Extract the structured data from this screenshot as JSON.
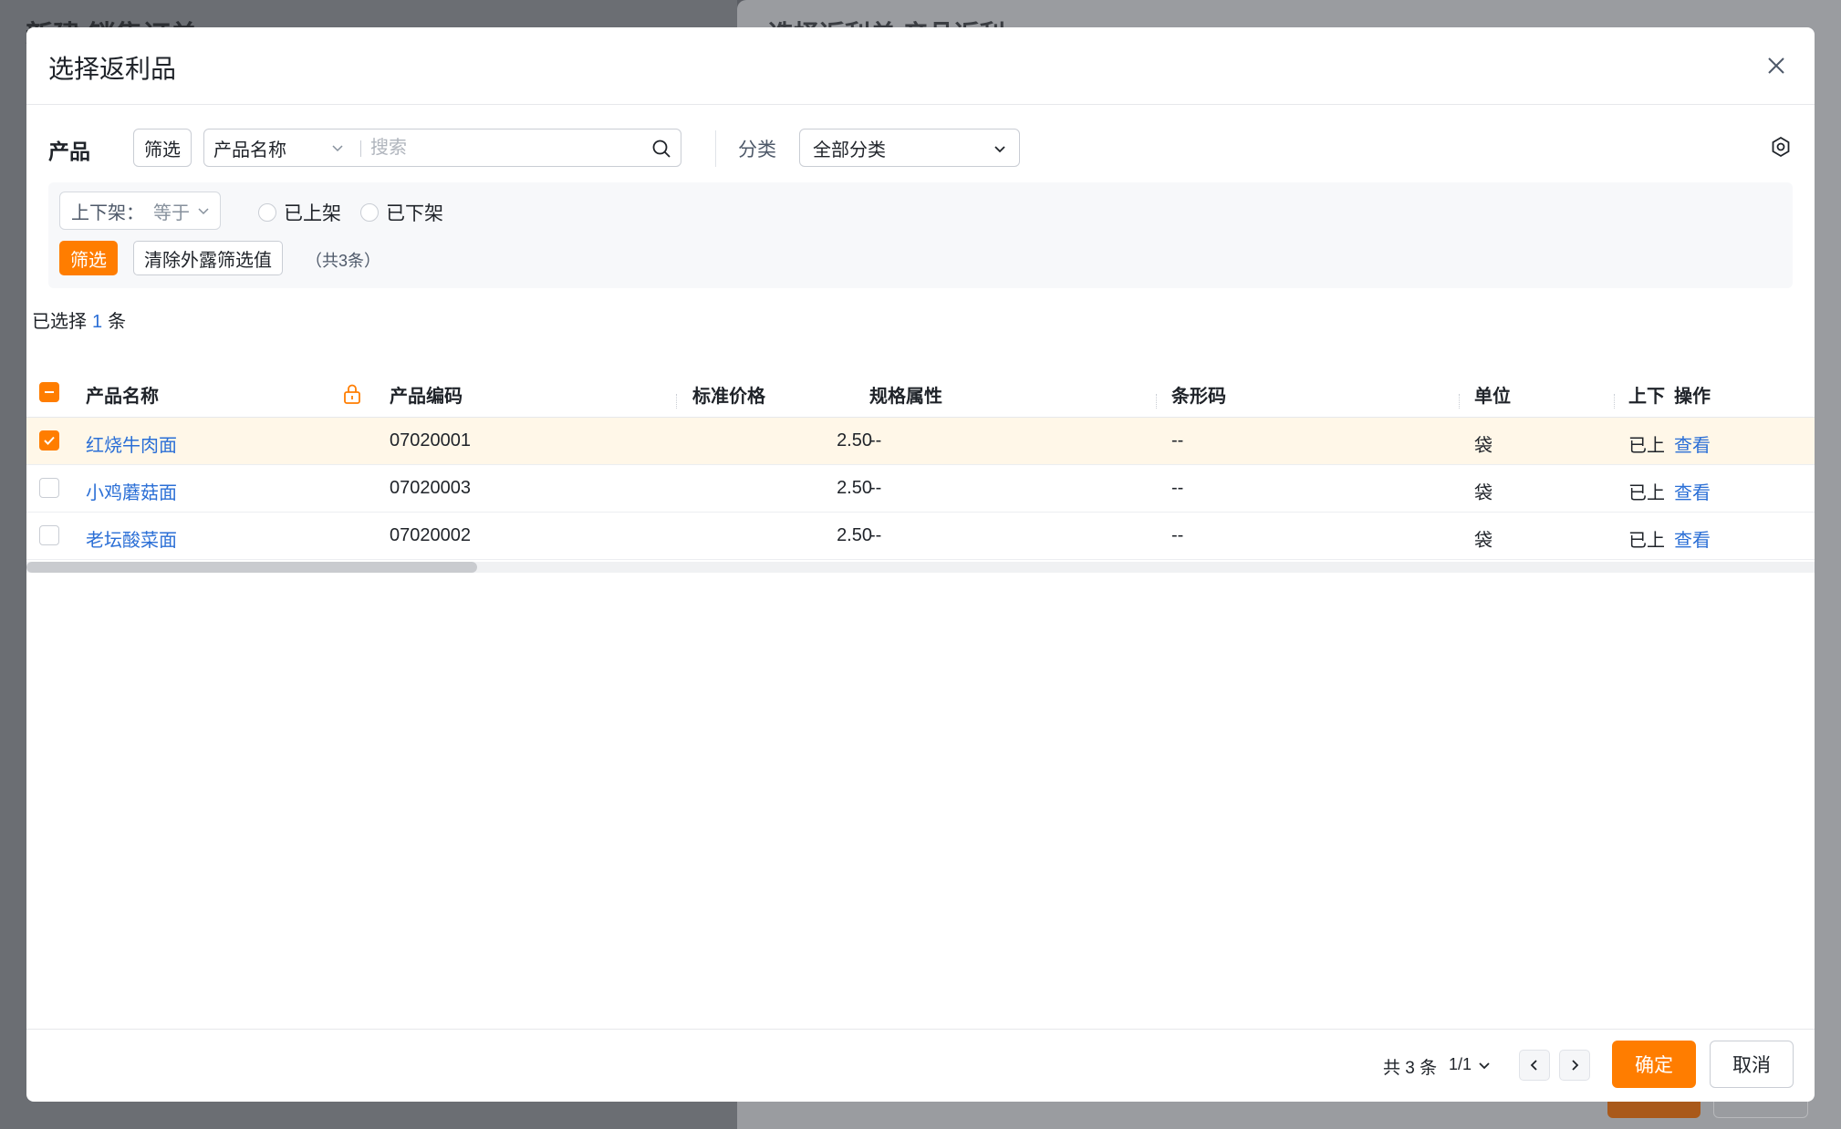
{
  "background": {
    "left_title": "新建 销售订单",
    "right_title": "选择返利单 产品返利"
  },
  "modal": {
    "title": "选择返利品",
    "toolbar": {
      "label": "产品",
      "filter_button": "筛选",
      "search_field": "产品名称",
      "search_placeholder": "搜索",
      "category_label": "分类",
      "category_value": "全部分类"
    },
    "filter_panel": {
      "field_label": "上下架：",
      "operator": "等于",
      "options": [
        "已上架",
        "已下架"
      ],
      "apply_button": "筛选",
      "clear_button": "清除外露筛选值",
      "count_text": "（共3条）"
    },
    "selected": {
      "prefix": "已选择",
      "count": "1",
      "suffix": "条"
    },
    "table": {
      "columns": [
        "产品名称",
        "产品编码",
        "标准价格",
        "规格属性",
        "条形码",
        "单位",
        "上下",
        "操作"
      ],
      "rows": [
        {
          "name": "红烧牛肉面",
          "code": "07020001",
          "price": "2.50",
          "spec": "--",
          "barcode": "--",
          "unit": "袋",
          "status": "已上",
          "action": "查看",
          "checked": true
        },
        {
          "name": "小鸡蘑菇面",
          "code": "07020003",
          "price": "2.50",
          "spec": "--",
          "barcode": "--",
          "unit": "袋",
          "status": "已上",
          "action": "查看",
          "checked": false
        },
        {
          "name": "老坛酸菜面",
          "code": "07020002",
          "price": "2.50",
          "spec": "--",
          "barcode": "--",
          "unit": "袋",
          "status": "已上",
          "action": "查看",
          "checked": false
        }
      ]
    },
    "pagination": {
      "total": "共 3 条",
      "page": "1/1"
    },
    "footer": {
      "confirm": "确定",
      "cancel": "取消"
    }
  },
  "colors": {
    "accent": "#ff7d00",
    "link": "#2b6fd6",
    "selected_row": "#fff7e8"
  }
}
